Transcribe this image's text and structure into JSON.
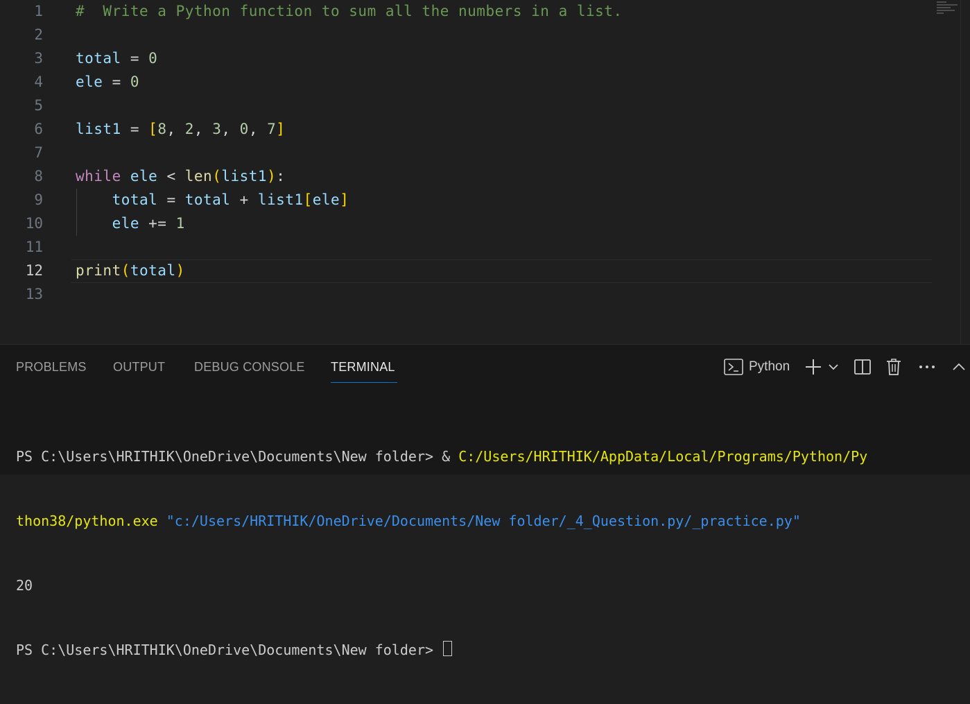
{
  "editor": {
    "active_line": "12",
    "lines": [
      {
        "num": "1",
        "tokens": [
          {
            "t": "#  Write a Python function to sum all the numbers in a list.",
            "c": "tk-comment"
          }
        ]
      },
      {
        "num": "2",
        "tokens": []
      },
      {
        "num": "3",
        "tokens": [
          {
            "t": "total",
            "c": "tk-var"
          },
          {
            "t": " = ",
            "c": "tk-op"
          },
          {
            "t": "0",
            "c": "tk-num"
          }
        ]
      },
      {
        "num": "4",
        "tokens": [
          {
            "t": "ele",
            "c": "tk-var"
          },
          {
            "t": " = ",
            "c": "tk-op"
          },
          {
            "t": "0",
            "c": "tk-num"
          }
        ]
      },
      {
        "num": "5",
        "tokens": []
      },
      {
        "num": "6",
        "tokens": [
          {
            "t": "list1",
            "c": "tk-var"
          },
          {
            "t": " = ",
            "c": "tk-op"
          },
          {
            "t": "[",
            "c": "tk-br1"
          },
          {
            "t": "8",
            "c": "tk-num"
          },
          {
            "t": ", ",
            "c": "tk-op"
          },
          {
            "t": "2",
            "c": "tk-num"
          },
          {
            "t": ", ",
            "c": "tk-op"
          },
          {
            "t": "3",
            "c": "tk-num"
          },
          {
            "t": ", ",
            "c": "tk-op"
          },
          {
            "t": "0",
            "c": "tk-num"
          },
          {
            "t": ", ",
            "c": "tk-op"
          },
          {
            "t": "7",
            "c": "tk-num"
          },
          {
            "t": "]",
            "c": "tk-br1"
          }
        ]
      },
      {
        "num": "7",
        "tokens": []
      },
      {
        "num": "8",
        "tokens": [
          {
            "t": "while",
            "c": "tk-kw"
          },
          {
            "t": " ",
            "c": "tk-op"
          },
          {
            "t": "ele",
            "c": "tk-var"
          },
          {
            "t": " < ",
            "c": "tk-op"
          },
          {
            "t": "len",
            "c": "tk-fn"
          },
          {
            "t": "(",
            "c": "tk-br1"
          },
          {
            "t": "list1",
            "c": "tk-var"
          },
          {
            "t": ")",
            "c": "tk-br1"
          },
          {
            "t": ":",
            "c": "tk-op"
          }
        ]
      },
      {
        "num": "9",
        "tokens": [
          {
            "t": "    ",
            "c": "tk-op"
          },
          {
            "t": "total",
            "c": "tk-var"
          },
          {
            "t": " = ",
            "c": "tk-op"
          },
          {
            "t": "total",
            "c": "tk-var"
          },
          {
            "t": " + ",
            "c": "tk-op"
          },
          {
            "t": "list1",
            "c": "tk-var"
          },
          {
            "t": "[",
            "c": "tk-br1"
          },
          {
            "t": "ele",
            "c": "tk-var"
          },
          {
            "t": "]",
            "c": "tk-br1"
          }
        ]
      },
      {
        "num": "10",
        "tokens": [
          {
            "t": "    ",
            "c": "tk-op"
          },
          {
            "t": "ele",
            "c": "tk-var"
          },
          {
            "t": " += ",
            "c": "tk-op"
          },
          {
            "t": "1",
            "c": "tk-num"
          }
        ]
      },
      {
        "num": "11",
        "tokens": []
      },
      {
        "num": "12",
        "tokens": [
          {
            "t": "print",
            "c": "tk-fn"
          },
          {
            "t": "(",
            "c": "tk-br1"
          },
          {
            "t": "total",
            "c": "tk-var"
          },
          {
            "t": ")",
            "c": "tk-br1"
          }
        ]
      },
      {
        "num": "13",
        "tokens": []
      }
    ]
  },
  "panel": {
    "tabs": [
      {
        "label": "PROBLEMS",
        "active": false
      },
      {
        "label": "OUTPUT",
        "active": false
      },
      {
        "label": "DEBUG CONSOLE",
        "active": false
      },
      {
        "label": "TERMINAL",
        "active": true
      }
    ],
    "toolbar": {
      "terminal_icon": "terminal-icon",
      "terminal_name": "Python",
      "icons": [
        "plus-icon",
        "chevron-down-icon",
        "split-icon",
        "trash-icon",
        "more-icon",
        "chevron-up-icon"
      ]
    },
    "terminal": {
      "prompt1": "PS C:\\Users\\HRITHIK\\OneDrive\\Documents\\New folder> & ",
      "exe_path_part1": "C:/Users/HRITHIK/AppData/Local/Programs/Python/Py",
      "exe_path_part2": "thon38/python.exe",
      "script_arg": "\"c:/Users/HRITHIK/OneDrive/Documents/New folder/_4_Question.py/_practice.py\"",
      "output": "20",
      "prompt2": "PS C:\\Users\\HRITHIK\\OneDrive\\Documents\\New folder> "
    }
  },
  "colors": {
    "editor_bg": "#1f1f1f",
    "panel_bg": "#181818",
    "accent": "#0078d4"
  }
}
